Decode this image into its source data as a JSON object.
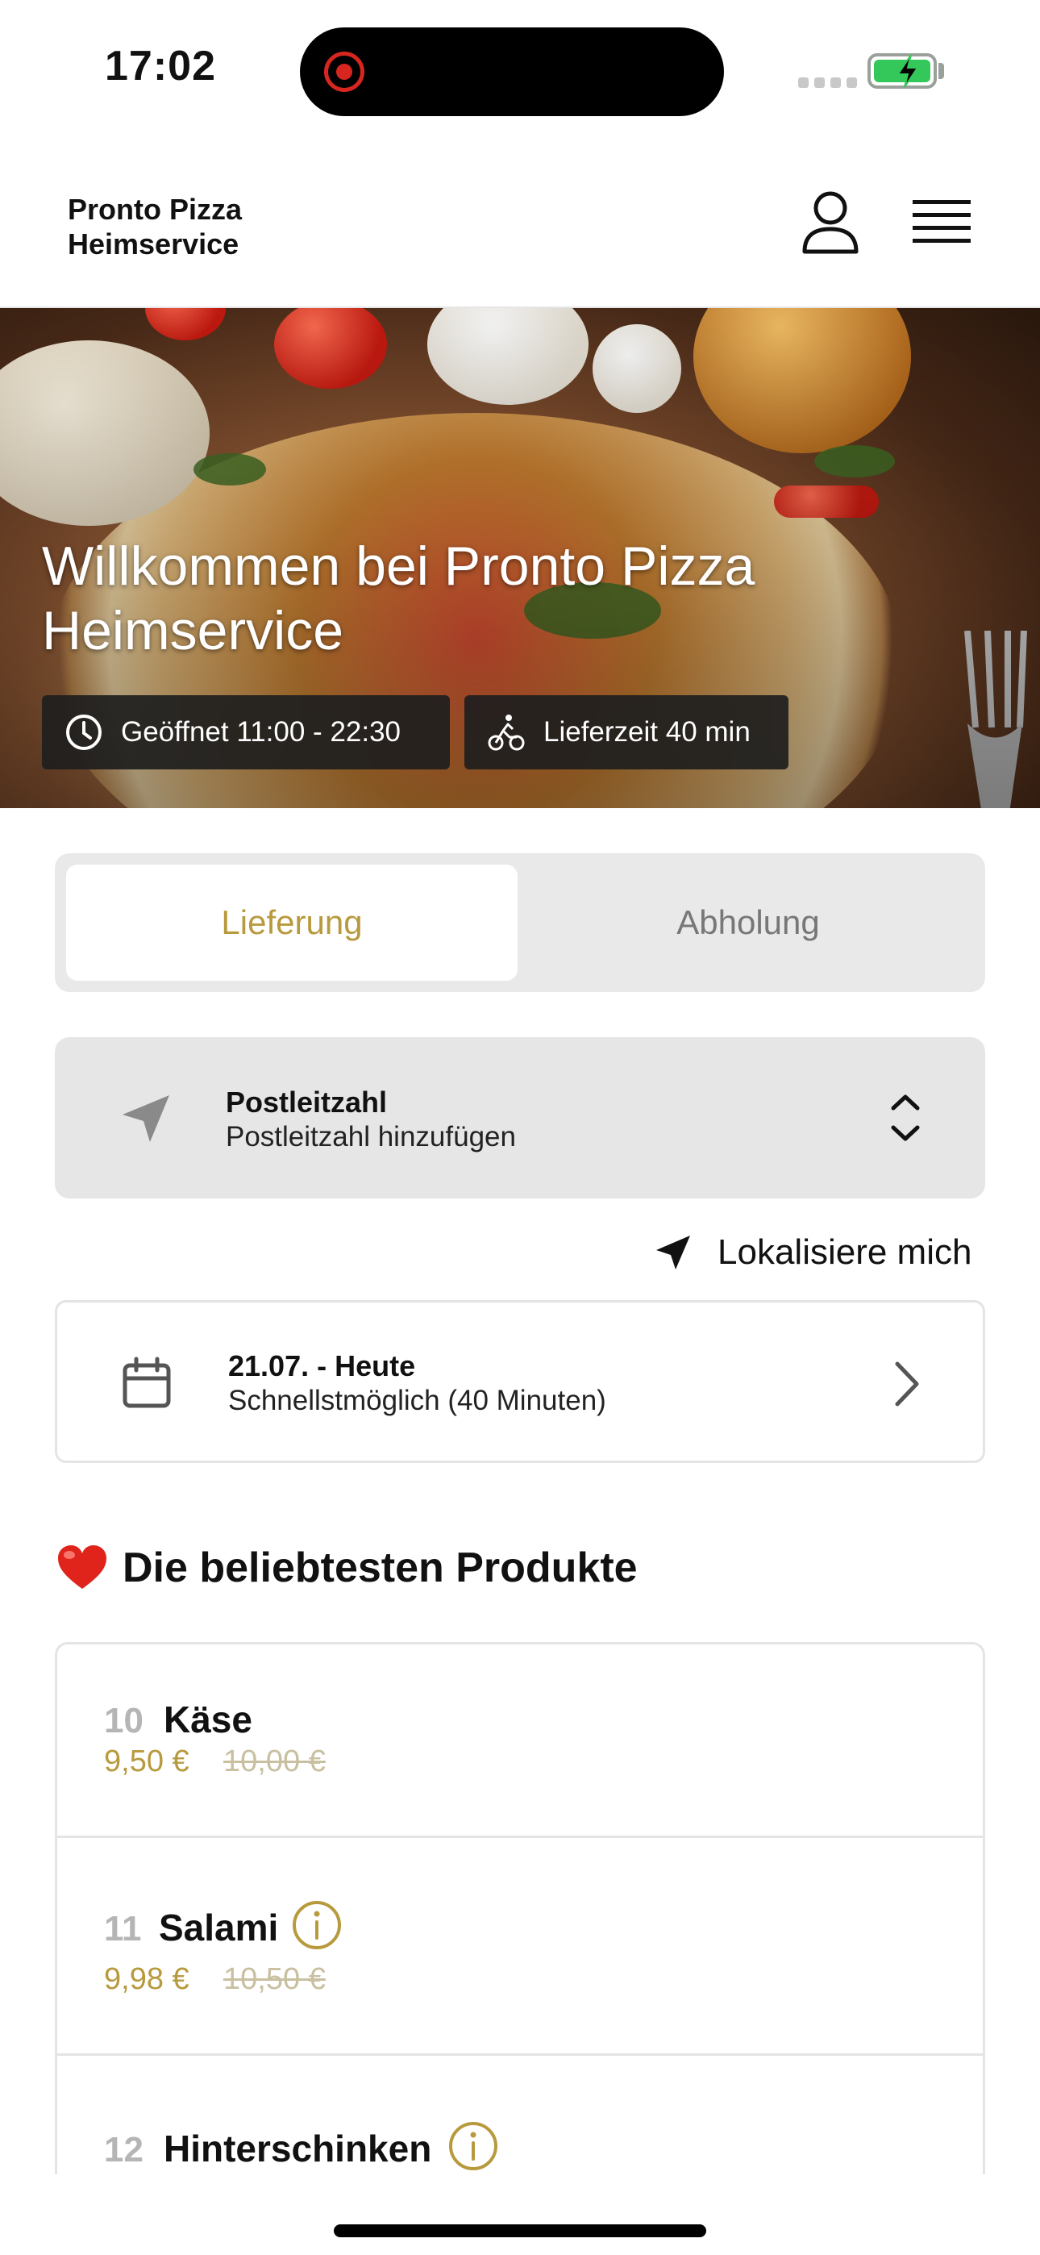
{
  "status_bar": {
    "time": "17:02"
  },
  "header": {
    "brand_line1": "Pronto Pizza",
    "brand_line2": "Heimservice",
    "user_icon": "user-icon",
    "menu_icon": "hamburger-menu-icon"
  },
  "hero": {
    "title": "Willkommen bei Pronto Pizza Heimservice",
    "open_hours": "Geöffnet 11:00 - 22:30",
    "delivery_time": "Lieferzeit 40 min"
  },
  "order_mode": {
    "options": [
      "Lieferung",
      "Abholung"
    ],
    "selected": "Lieferung",
    "accent_color": "#b89a3e"
  },
  "postal": {
    "label": "Postleitzahl",
    "value": "Postleitzahl hinzufügen"
  },
  "locate": {
    "label": "Lokalisiere mich"
  },
  "date": {
    "label": "21.07. - Heute",
    "value": "Schnellstmöglich (40 Minuten)"
  },
  "popular": {
    "title": "Die beliebtesten Produkte",
    "emoji_icon": "heart-icon",
    "products": [
      {
        "number": "10",
        "name": "Käse",
        "price": "9,50 €",
        "old_price": "10,00 €",
        "info": false
      },
      {
        "number": "11",
        "name": "Salami",
        "price": "9,98 €",
        "old_price": "10,50 €",
        "info": true
      },
      {
        "number": "12",
        "name": "Hinterschinken",
        "info": true
      }
    ]
  }
}
